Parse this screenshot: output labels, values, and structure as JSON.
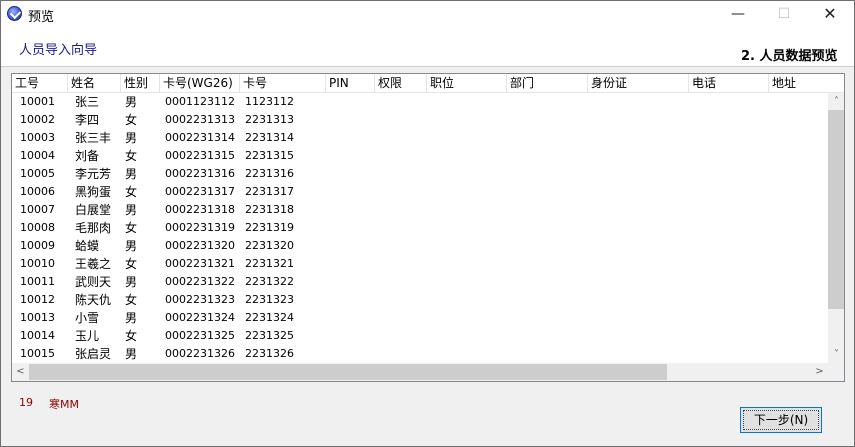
{
  "window": {
    "title": "预览",
    "minimize_glyph": "—",
    "maximize_glyph": "☐",
    "close_glyph": "✕"
  },
  "header": {
    "wizard_title": "人员导入向导",
    "step_title": "2. 人员数据预览"
  },
  "table": {
    "columns": [
      "工号",
      "姓名",
      "性别",
      "卡号(WG26)",
      "卡号",
      "PIN",
      "权限",
      "职位",
      "部门",
      "身份证",
      "电话",
      "地址"
    ],
    "rows": [
      [
        "10001",
        "张三",
        "男",
        "0001123112",
        "1123112"
      ],
      [
        "10002",
        "李四",
        "女",
        "0002231313",
        "2231313"
      ],
      [
        "10003",
        "张三丰",
        "男",
        "0002231314",
        "2231314"
      ],
      [
        "10004",
        "刘备",
        "女",
        "0002231315",
        "2231315"
      ],
      [
        "10005",
        "李元芳",
        "男",
        "0002231316",
        "2231316"
      ],
      [
        "10006",
        "黑狗蛋",
        "女",
        "0002231317",
        "2231317"
      ],
      [
        "10007",
        "白展堂",
        "男",
        "0002231318",
        "2231318"
      ],
      [
        "10008",
        "毛那肉",
        "女",
        "0002231319",
        "2231319"
      ],
      [
        "10009",
        "蛤蟆",
        "男",
        "0002231320",
        "2231320"
      ],
      [
        "10010",
        "王羲之",
        "女",
        "0002231321",
        "2231321"
      ],
      [
        "10011",
        "武则天",
        "男",
        "0002231322",
        "2231322"
      ],
      [
        "10012",
        "陈天仇",
        "女",
        "0002231323",
        "2231323"
      ],
      [
        "10013",
        "小雪",
        "男",
        "0002231324",
        "2231324"
      ],
      [
        "10014",
        "玉儿",
        "女",
        "0002231325",
        "2231325"
      ],
      [
        "10015",
        "张启灵",
        "男",
        "0002231326",
        "2231326"
      ]
    ]
  },
  "scrollbars": {
    "up_arrow": "˄",
    "down_arrow": "˅",
    "left_arrow": "<",
    "right_arrow": ">"
  },
  "status": {
    "count": "19",
    "text": "寒MM"
  },
  "buttons": {
    "next_label": "下一步(N)"
  }
}
